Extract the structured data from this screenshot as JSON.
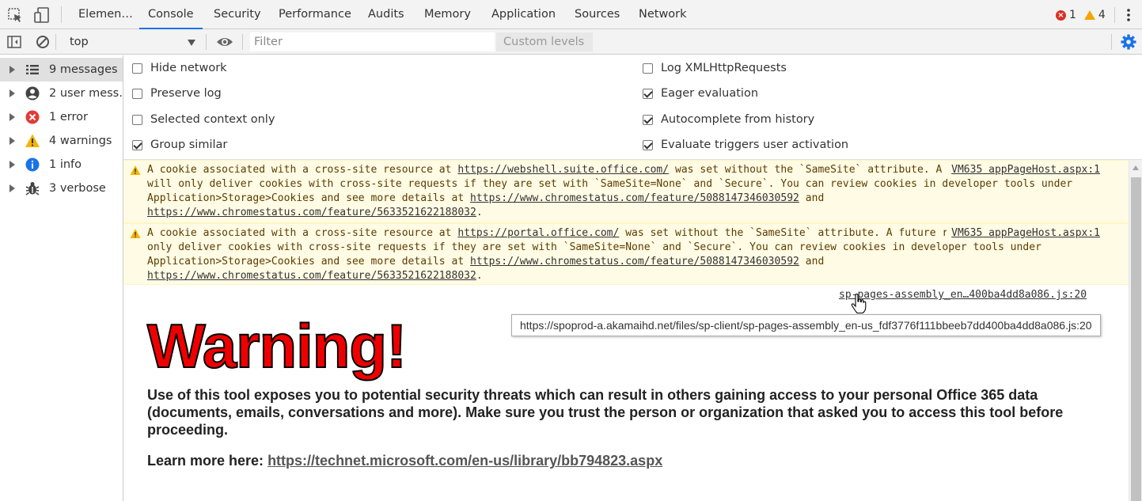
{
  "tabs": [
    "Elemen…",
    "Console",
    "Security",
    "Performance",
    "Audits",
    "Memory",
    "Application",
    "Sources",
    "Network"
  ],
  "counts": {
    "errors": "1",
    "warnings": "4"
  },
  "toolbar": {
    "context": "top",
    "filter_placeholder": "Filter",
    "levels_label": "Custom levels ▾"
  },
  "sidebar": {
    "items": [
      {
        "label": "9 messages",
        "icon": "list-icon"
      },
      {
        "label": "2 user mess…",
        "icon": "user-icon"
      },
      {
        "label": "1 error",
        "icon": "error-icon"
      },
      {
        "label": "4 warnings",
        "icon": "warning-icon"
      },
      {
        "label": "1 info",
        "icon": "info-icon"
      },
      {
        "label": "3 verbose",
        "icon": "bug-icon"
      }
    ]
  },
  "settings": {
    "left": [
      {
        "label": "Hide network",
        "checked": false
      },
      {
        "label": "Preserve log",
        "checked": false
      },
      {
        "label": "Selected context only",
        "checked": false
      },
      {
        "label": "Group similar",
        "checked": true
      }
    ],
    "right": [
      {
        "label": "Log XMLHttpRequests",
        "checked": false
      },
      {
        "label": "Eager evaluation",
        "checked": true
      },
      {
        "label": "Autocomplete from history",
        "checked": true
      },
      {
        "label": "Evaluate triggers user activation",
        "checked": true
      }
    ]
  },
  "messages": [
    {
      "source": "VM635 appPageHost.aspx:1",
      "part1": "A cookie associated with a cross-site resource at ",
      "link1": "https://webshell.suite.office.com/",
      "part2": " was set without the `SameSite` attribute. A future release of Chrome will only deliver cookies with cross-site requests if they are set with `SameSite=None` and `Secure`. You can review cookies in developer tools under Application>Storage>Cookies and see more details at ",
      "link2": "https://www.chromestatus.com/feature/5088147346030592",
      "part3": " and ",
      "link3": "https://www.chromestatus.com/feature/5633521622188032",
      "part4": "."
    },
    {
      "source": "VM635 appPageHost.aspx:1",
      "part1": "A cookie associated with a cross-site resource at ",
      "link1": "https://portal.office.com/",
      "part2": " was set without the `SameSite` attribute. A future release of Chrome will only deliver cookies with cross-site requests if they are set with `SameSite=None` and `Secure`. You can review cookies in developer tools under Application>Storage>Cookies and see more details at ",
      "link2": "https://www.chromestatus.com/feature/5088147346030592",
      "part3": " and ",
      "link3": "https://www.chromestatus.com/feature/5633521622188032",
      "part4": "."
    }
  ],
  "log_source": "sp-pages-assembly_en…400ba4dd8a086.js:20",
  "tooltip": "https://spoprod-a.akamaihd.net/files/sp-client/sp-pages-assembly_en-us_fdf3776f111bbeeb7dd400ba4dd8a086.js:20",
  "warning": {
    "title": "Warning!",
    "body": "Use of this tool exposes you to potential security threats which can result in others gaining access to your personal Office 365 data (documents, emails, conversations and more). Make sure you trust the person or organization that asked you to access this tool before proceeding.",
    "learn_more_label": "Learn more here: ",
    "learn_more_link": "https://technet.microsoft.com/en-us/library/bb794823.aspx"
  }
}
